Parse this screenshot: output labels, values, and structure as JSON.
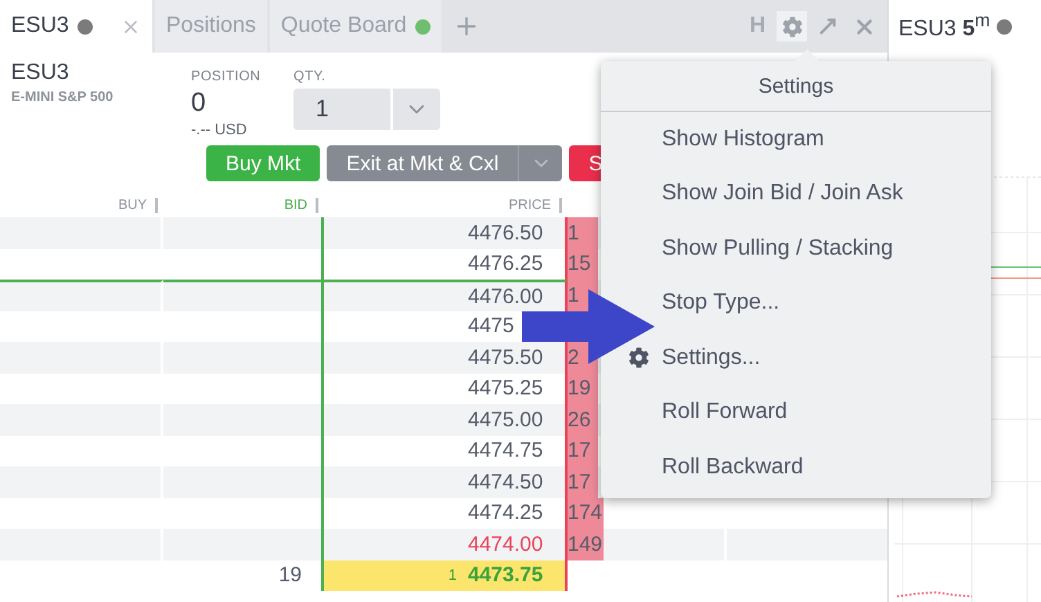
{
  "tabs": [
    {
      "label": "ESU3",
      "selected": true,
      "color": "#7b7b7b",
      "closable": true
    },
    {
      "label": "Positions",
      "selected": false
    },
    {
      "label": "Quote Board",
      "selected": false,
      "color": "#6dbf6d"
    }
  ],
  "toolbar": {
    "hotkey": "H"
  },
  "chart_tab": {
    "symbol": "ESU3",
    "interval": "5",
    "unit": "m",
    "color": "#7b7b7b"
  },
  "instrument": {
    "symbol": "ESU3",
    "name": "E-MINI S&P 500"
  },
  "position": {
    "label": "POSITION",
    "value": "0",
    "pnl": "-.-- USD"
  },
  "quantity": {
    "label": "QTY.",
    "value": "1"
  },
  "actions": [
    {
      "label": "Buy Mkt",
      "kind": "buy"
    },
    {
      "label": "Exit at Mkt & Cxl",
      "kind": "exit"
    },
    {
      "label": "S",
      "kind": "sell"
    }
  ],
  "ladder": {
    "columns": [
      {
        "label": "BUY",
        "kind": "plain"
      },
      {
        "label": "BID",
        "kind": "bid"
      },
      {
        "label": "PRICE",
        "kind": "plain"
      }
    ],
    "rows": [
      {
        "kind": "level",
        "price": "4476.50",
        "ask": "1"
      },
      {
        "kind": "level",
        "price": "4476.25",
        "ask": "15"
      },
      {
        "kind": "level",
        "price": "4476.00",
        "ask": "1",
        "cursor_line": true
      },
      {
        "kind": "level",
        "price": "4475"
      },
      {
        "kind": "level",
        "price": "4475.50",
        "ask": "2"
      },
      {
        "kind": "level",
        "price": "4475.25",
        "ask": "19"
      },
      {
        "kind": "level",
        "price": "4475.00",
        "ask": "26"
      },
      {
        "kind": "level",
        "price": "4474.75",
        "ask": "17"
      },
      {
        "kind": "level",
        "price": "4474.50",
        "ask": "17"
      },
      {
        "kind": "level",
        "price": "4474.25",
        "ask": "174"
      },
      {
        "kind": "best_ask",
        "price": "4474.00",
        "ask": "149"
      },
      {
        "kind": "last",
        "price": "4473.75",
        "bid": "19",
        "trade": "1"
      }
    ]
  },
  "menu": {
    "title": "Settings",
    "items": [
      {
        "label": "Show Histogram",
        "kind": "plain"
      },
      {
        "label": "Show Join Bid / Join Ask",
        "kind": "plain"
      },
      {
        "label": "Show Pulling / Stacking",
        "kind": "plain"
      },
      {
        "label": "Stop Type...",
        "kind": "plain"
      },
      {
        "label": "Settings...",
        "kind": "gear"
      },
      {
        "label": "Roll Forward",
        "kind": "plain"
      },
      {
        "label": "Roll Backward",
        "kind": "plain"
      }
    ]
  }
}
